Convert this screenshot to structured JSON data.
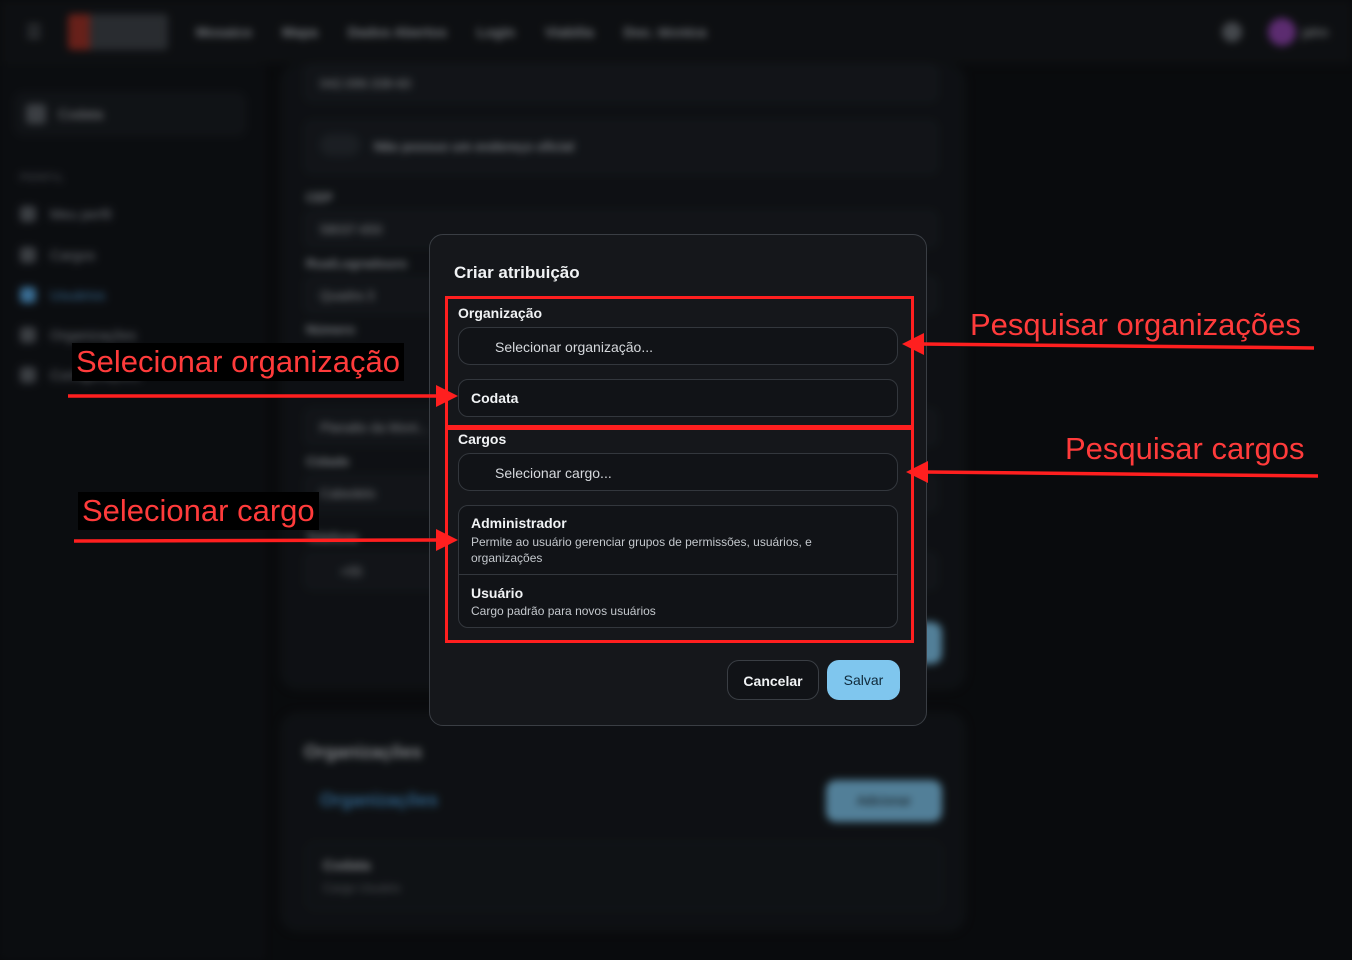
{
  "background": {
    "topbar": {
      "nav": [
        "Mosaico",
        "Mapa",
        "Dados Abertos",
        "Login",
        "Viabilia",
        "Doc. técnica"
      ],
      "user": "jahn"
    },
    "sidebar": {
      "org": "Codata",
      "section": "PERFIL",
      "items": [
        "Meu perfil",
        "Cargos",
        "Usuários",
        "Organizações",
        "Configurações"
      ]
    },
    "form": {
      "cpf_value": "042.099.338-60",
      "toggle_label": "Não possuo um endereço oficial",
      "cep_label": "CEP",
      "cep_value": "58037-650",
      "street_label": "Rua/Logradouro",
      "street_value": "Quadra 3",
      "number_label": "Número",
      "neighborhood_value": "Planalto da Mont...",
      "city_label": "Cidade",
      "city_value": "Cabedelo",
      "phone_label": "Telefone",
      "phone_code": "+55"
    },
    "organizations_card": {
      "title": "Organizações",
      "tab": "Organizações",
      "add_button": "Adicionar",
      "row_name": "Codata",
      "row_role": "Cargo Usuário"
    }
  },
  "modal": {
    "title": "Criar atribuição",
    "organization": {
      "label": "Organização",
      "search_placeholder": "Selecionar organização...",
      "options": [
        "Codata"
      ]
    },
    "roles": {
      "label": "Cargos",
      "search_placeholder": "Selecionar cargo...",
      "options": [
        {
          "name": "Administrador",
          "description": "Permite ao usuário gerenciar grupos de permissões, usuários, e organizações"
        },
        {
          "name": "Usuário",
          "description": "Cargo padrão para novos usuários"
        }
      ]
    },
    "cancel_label": "Cancelar",
    "save_label": "Salvar"
  },
  "annotations": {
    "select_org": "Selecionar organização",
    "search_orgs": "Pesquisar organizações",
    "search_roles": "Pesquisar cargos",
    "select_role": "Selecionar cargo",
    "color": "#ff1f1f"
  }
}
